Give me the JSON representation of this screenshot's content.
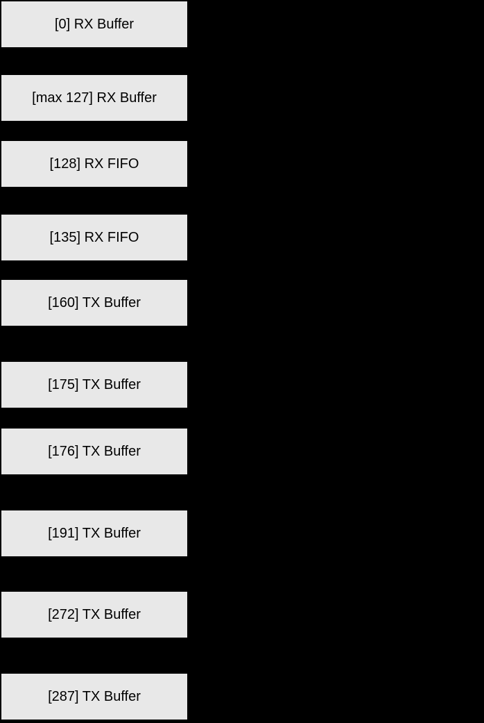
{
  "diagram": {
    "blocks": [
      {
        "label": "[0] RX Buffer"
      },
      {
        "label": "[max 127] RX Buffer"
      },
      {
        "label": "[128] RX FIFO"
      },
      {
        "label": "[135] RX FIFO"
      },
      {
        "label": "[160] TX Buffer"
      },
      {
        "label": "[175] TX Buffer"
      },
      {
        "label": "[176] TX Buffer"
      },
      {
        "label": "[191] TX Buffer"
      },
      {
        "label": "[272] TX Buffer"
      },
      {
        "label": "[287] TX Buffer"
      }
    ]
  },
  "colors": {
    "background": "#000000",
    "block_fill": "#e8e8e8",
    "text": "#000000"
  }
}
